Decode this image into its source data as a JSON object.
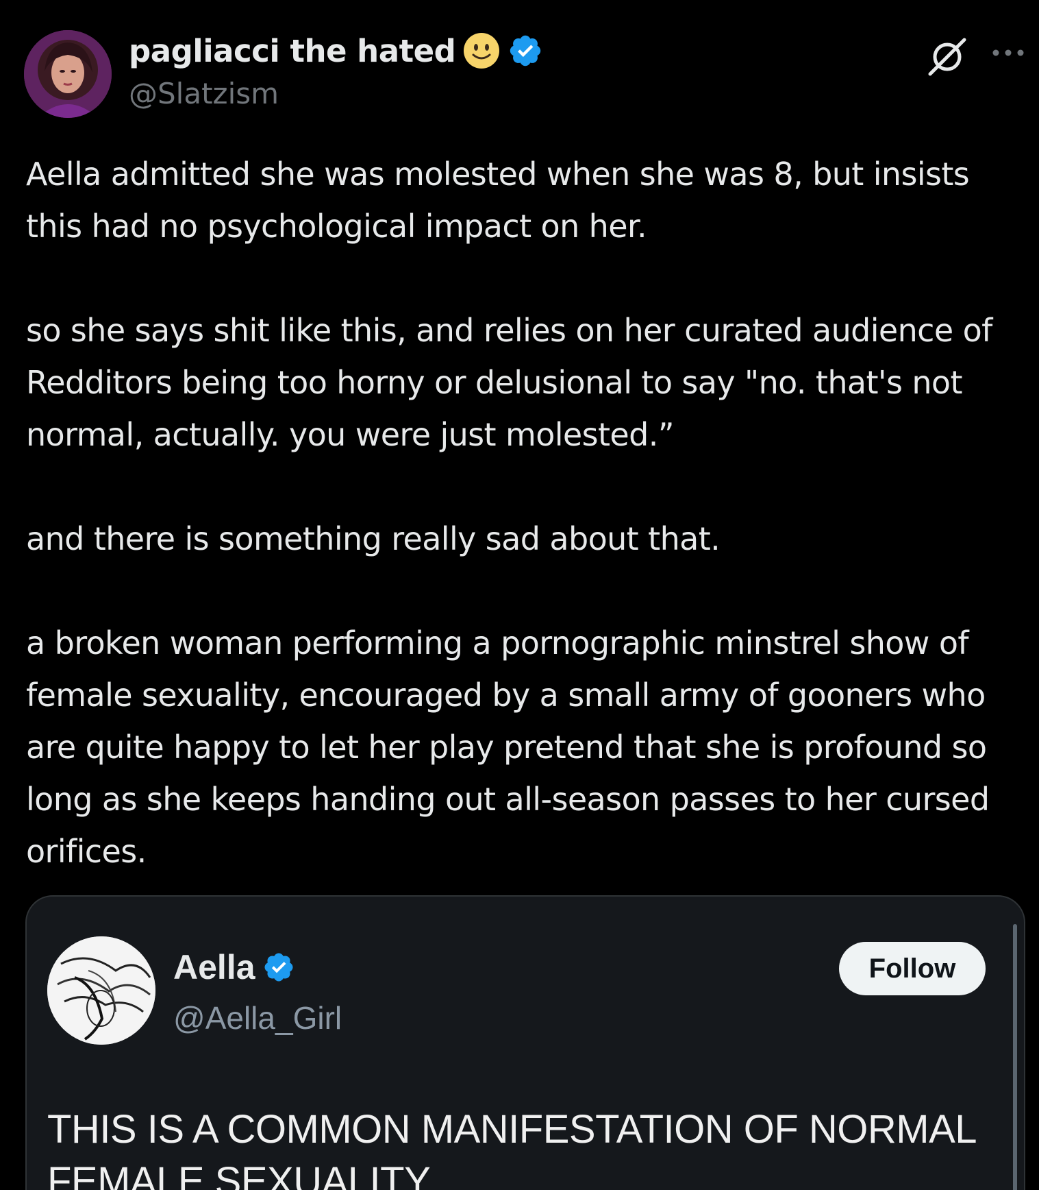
{
  "tweet": {
    "author": {
      "display_name": "pagliacci the hated",
      "handle": "@Slatzism",
      "verified": true,
      "emoji": "slightly-smiling-face"
    },
    "paragraphs": [
      "Aella admitted she was molested when she was 8, but insists this had no psychological impact on her.",
      "so she says shit like this, and relies on her curated audience of Redditors being too horny or delusional to say \"no. that's not normal, actually. you were just molested.”",
      "and there is something really sad about that.",
      "a broken woman performing a pornographic minstrel show of female sexuality, encouraged by a small army of gooners who are quite happy to let her play pretend that she is profound so long as she keeps handing out all-season passes to her cursed orifices."
    ]
  },
  "quoted": {
    "display_name": "Aella",
    "handle": "@Aella_Girl",
    "verified": true,
    "follow_label": "Follow",
    "text": "THIS IS A COMMON MANIFESTATION OF NORMAL FEMALE SEXUALITY"
  },
  "colors": {
    "background": "#000000",
    "text": "#e7e9ea",
    "secondary": "#71767b",
    "verified_blue": "#1d9bf0",
    "card_bg": "#15181c"
  }
}
